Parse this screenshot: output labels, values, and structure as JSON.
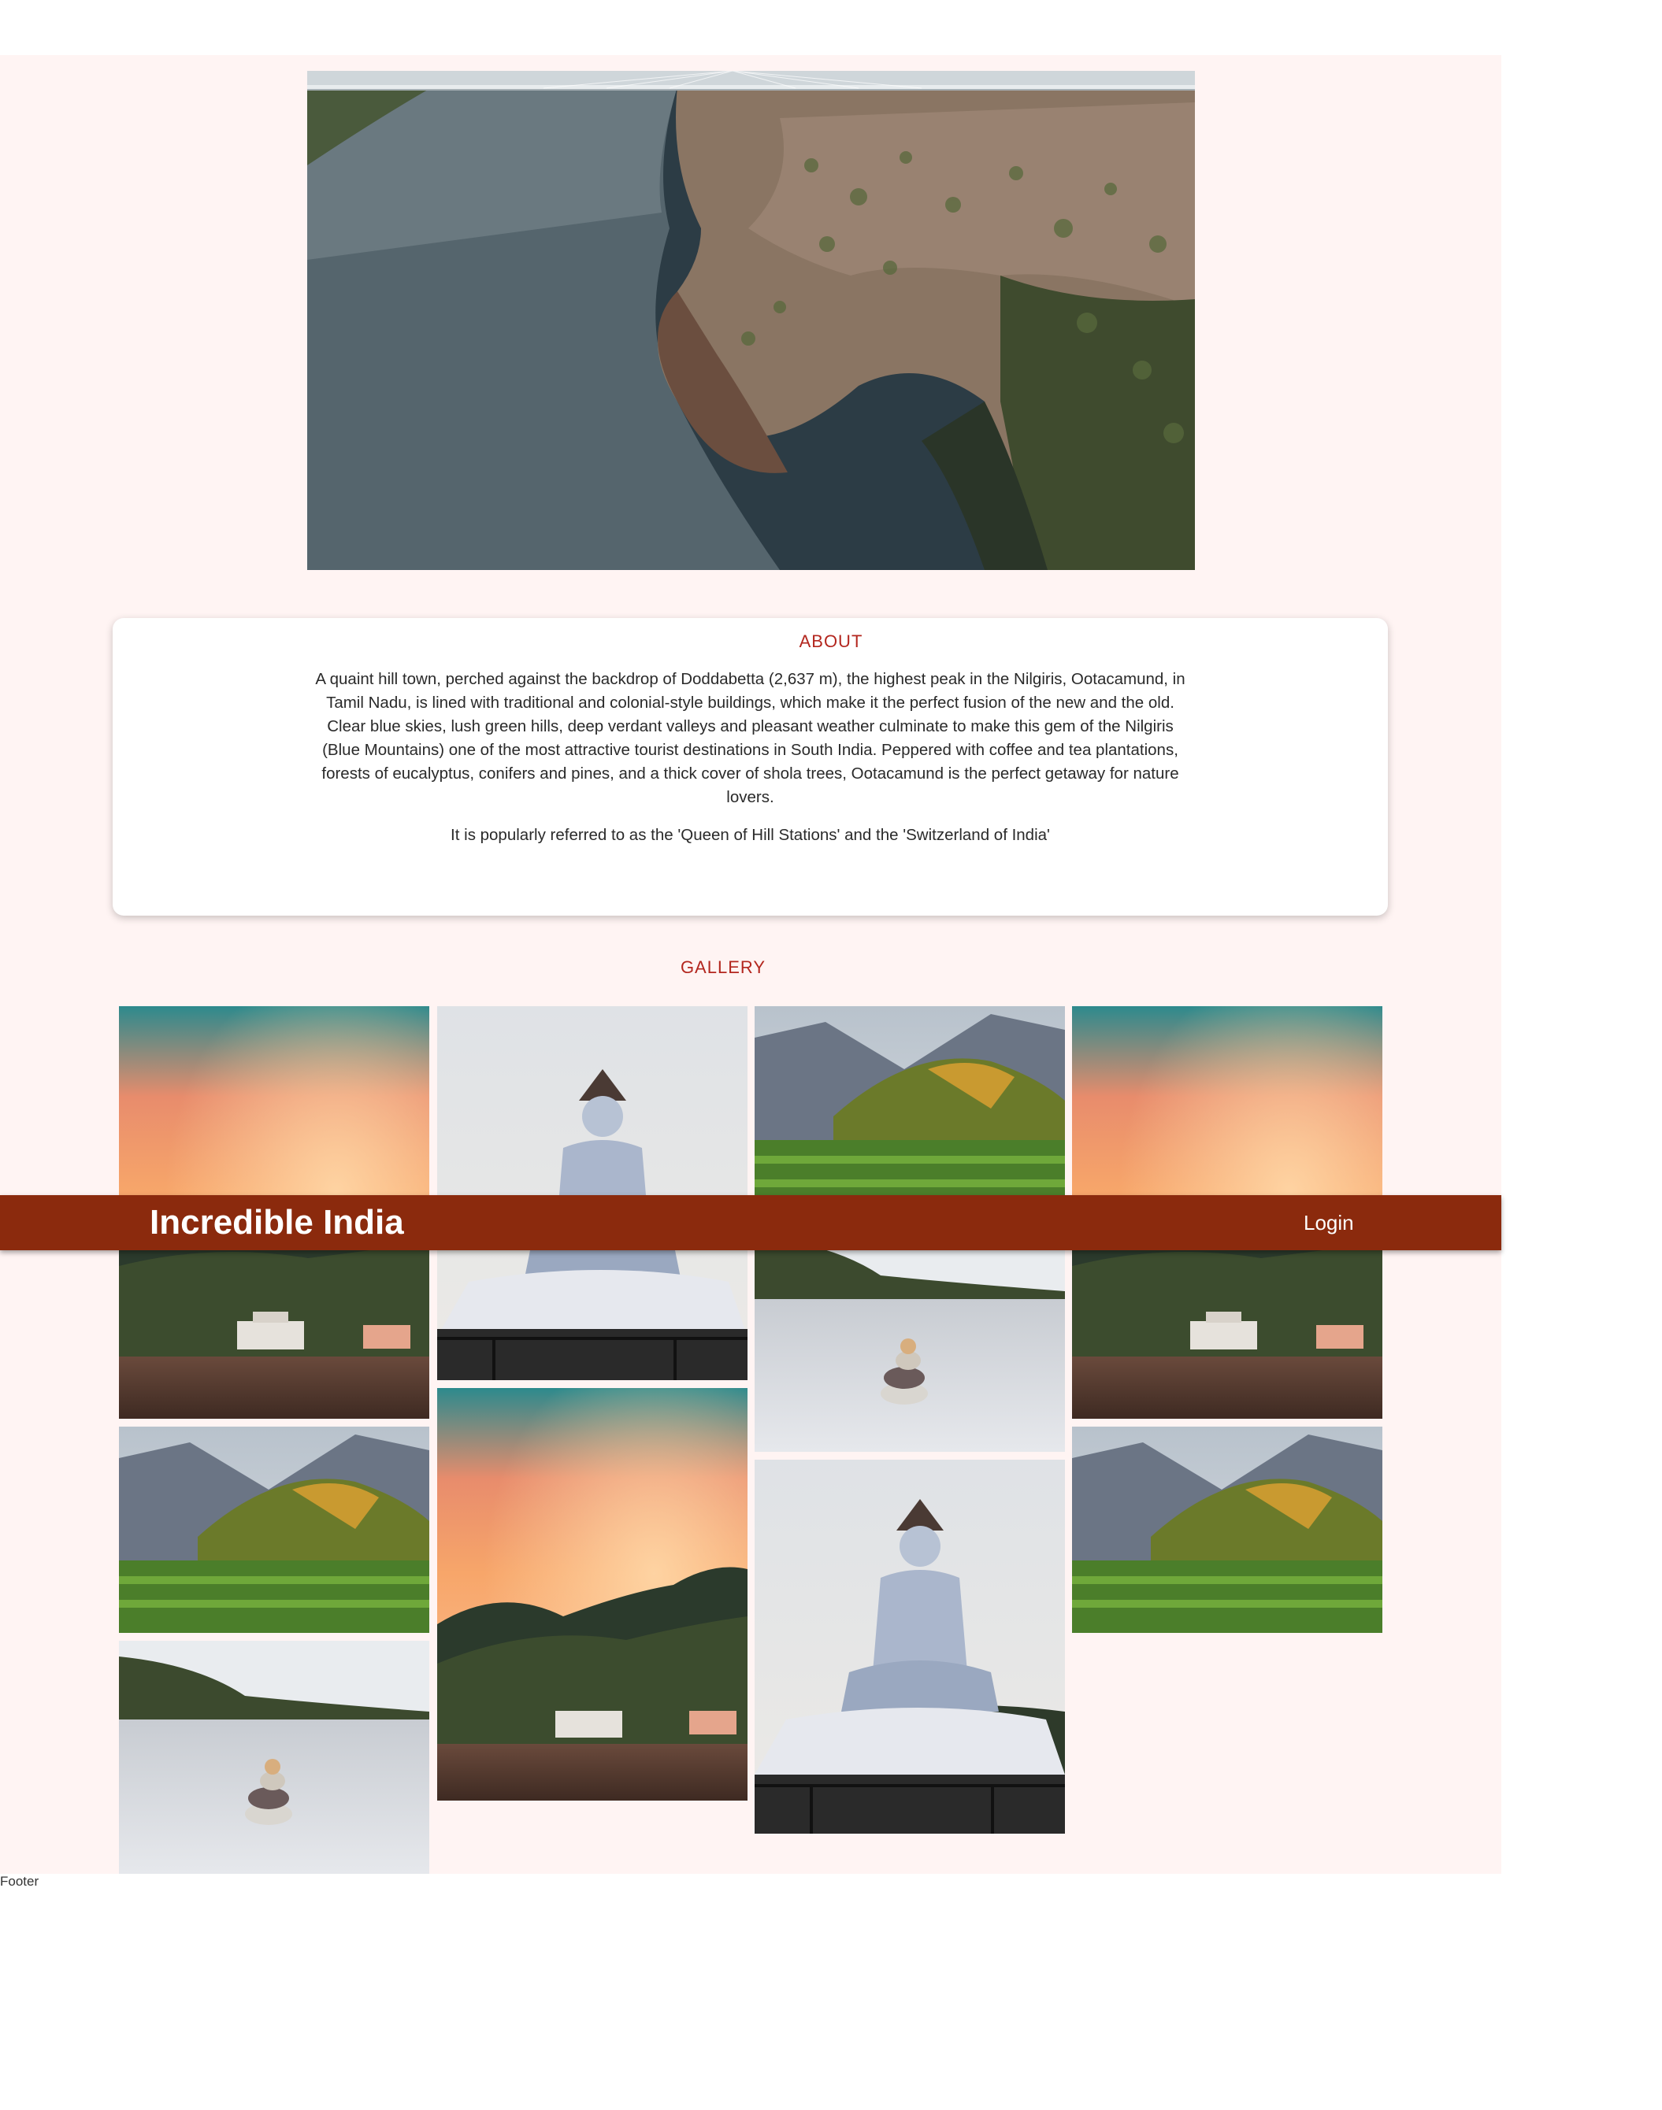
{
  "navbar": {
    "brand": "Incredible India",
    "login_label": "Login"
  },
  "hero": {
    "image_alt": "aerial view of river gorge"
  },
  "about": {
    "title": "ABOUT",
    "paragraph_1": "A quaint hill town, perched against the backdrop of Doddabetta (2,637 m), the highest peak in the Nilgiris, Ootacamund, in Tamil Nadu, is lined with traditional and colonial-style buildings, which make it the perfect fusion of the new and the old. Clear blue skies, lush green hills, deep verdant valleys and pleasant weather culminate to make this gem of the Nilgiris (Blue Mountains) one of the most attractive tourist destinations in South India. Peppered with coffee and tea plantations, forests of eucalyptus, conifers and pines, and a thick cover of shola trees, Ootacamund is the perfect getaway for nature lovers.",
    "paragraph_2": "It is popularly referred to as the 'Queen of Hill Stations' and the 'Switzerland of India'"
  },
  "gallery": {
    "title": "GALLERY",
    "images": [
      {
        "column": 1,
        "subject": "sunset-sky-riverside-hotel"
      },
      {
        "column": 1,
        "subject": "green-mountain-valley"
      },
      {
        "column": 1,
        "subject": "stacked-stones-on-sand"
      },
      {
        "column": 2,
        "subject": "shiva-statue"
      },
      {
        "column": 2,
        "subject": "sunset-sky-riverside-hotel"
      },
      {
        "column": 3,
        "subject": "green-mountain-valley"
      },
      {
        "column": 3,
        "subject": "stacked-stones-on-sand"
      },
      {
        "column": 3,
        "subject": "shiva-statue"
      },
      {
        "column": 4,
        "subject": "sunset-sky-riverside-hotel"
      },
      {
        "column": 4,
        "subject": "green-mountain-valley"
      }
    ]
  },
  "footer": {
    "text": "Footer"
  },
  "colors": {
    "navbar_bg": "#8b2a0d",
    "page_bg": "#fff4f3",
    "heading_accent": "#b3261e"
  }
}
